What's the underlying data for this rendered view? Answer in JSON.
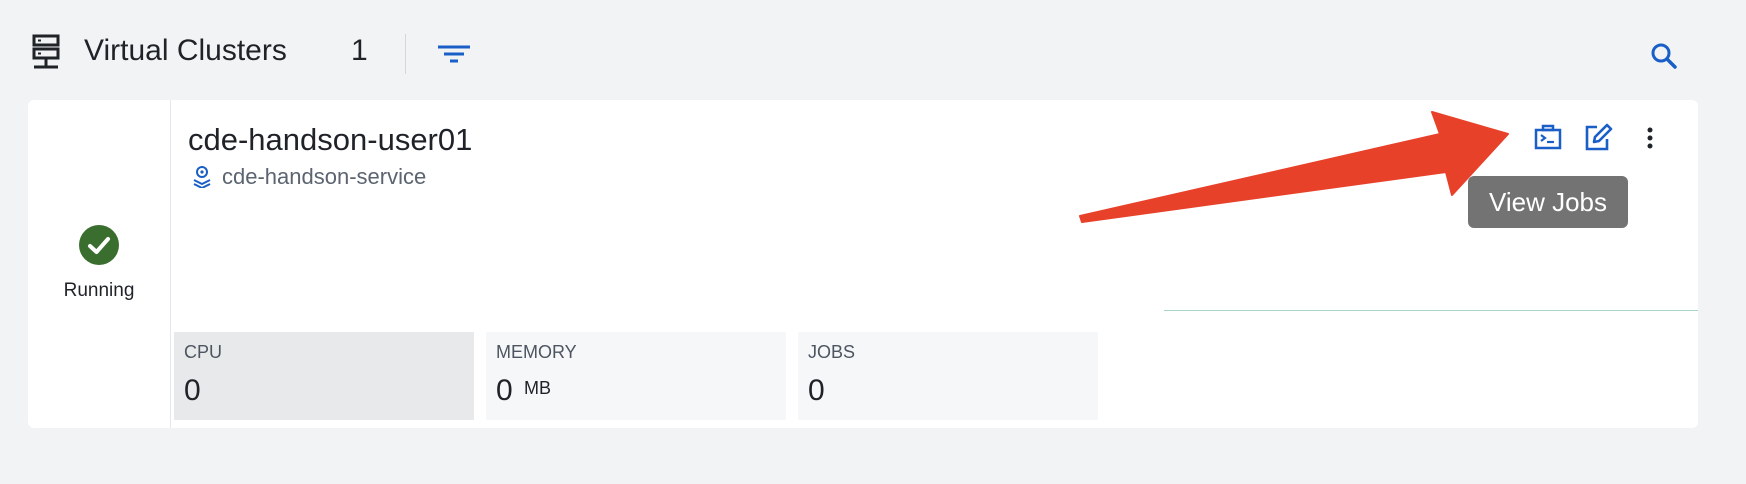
{
  "header": {
    "title": "Virtual Clusters",
    "count": "1"
  },
  "cluster": {
    "status": "Running",
    "name": "cde-handson-user01",
    "service": "cde-handson-service",
    "tooltip": "View Jobs",
    "stats": {
      "cpu": {
        "label": "CPU",
        "value": "0"
      },
      "memory": {
        "label": "MEMORY",
        "value": "0",
        "unit": "MB"
      },
      "jobs": {
        "label": "JOBS",
        "value": "0"
      }
    }
  },
  "colors": {
    "accent": "#1a5fc8",
    "status_ok": "#3a6e2e",
    "annotation_arrow": "#e8412a"
  },
  "icons": {
    "header": "server-icon",
    "filter": "filter-icon",
    "search": "search-icon",
    "service": "service-icon",
    "view_jobs": "terminal-icon",
    "edit": "edit-icon",
    "more": "more-vertical-icon",
    "status": "check-circle-icon"
  }
}
